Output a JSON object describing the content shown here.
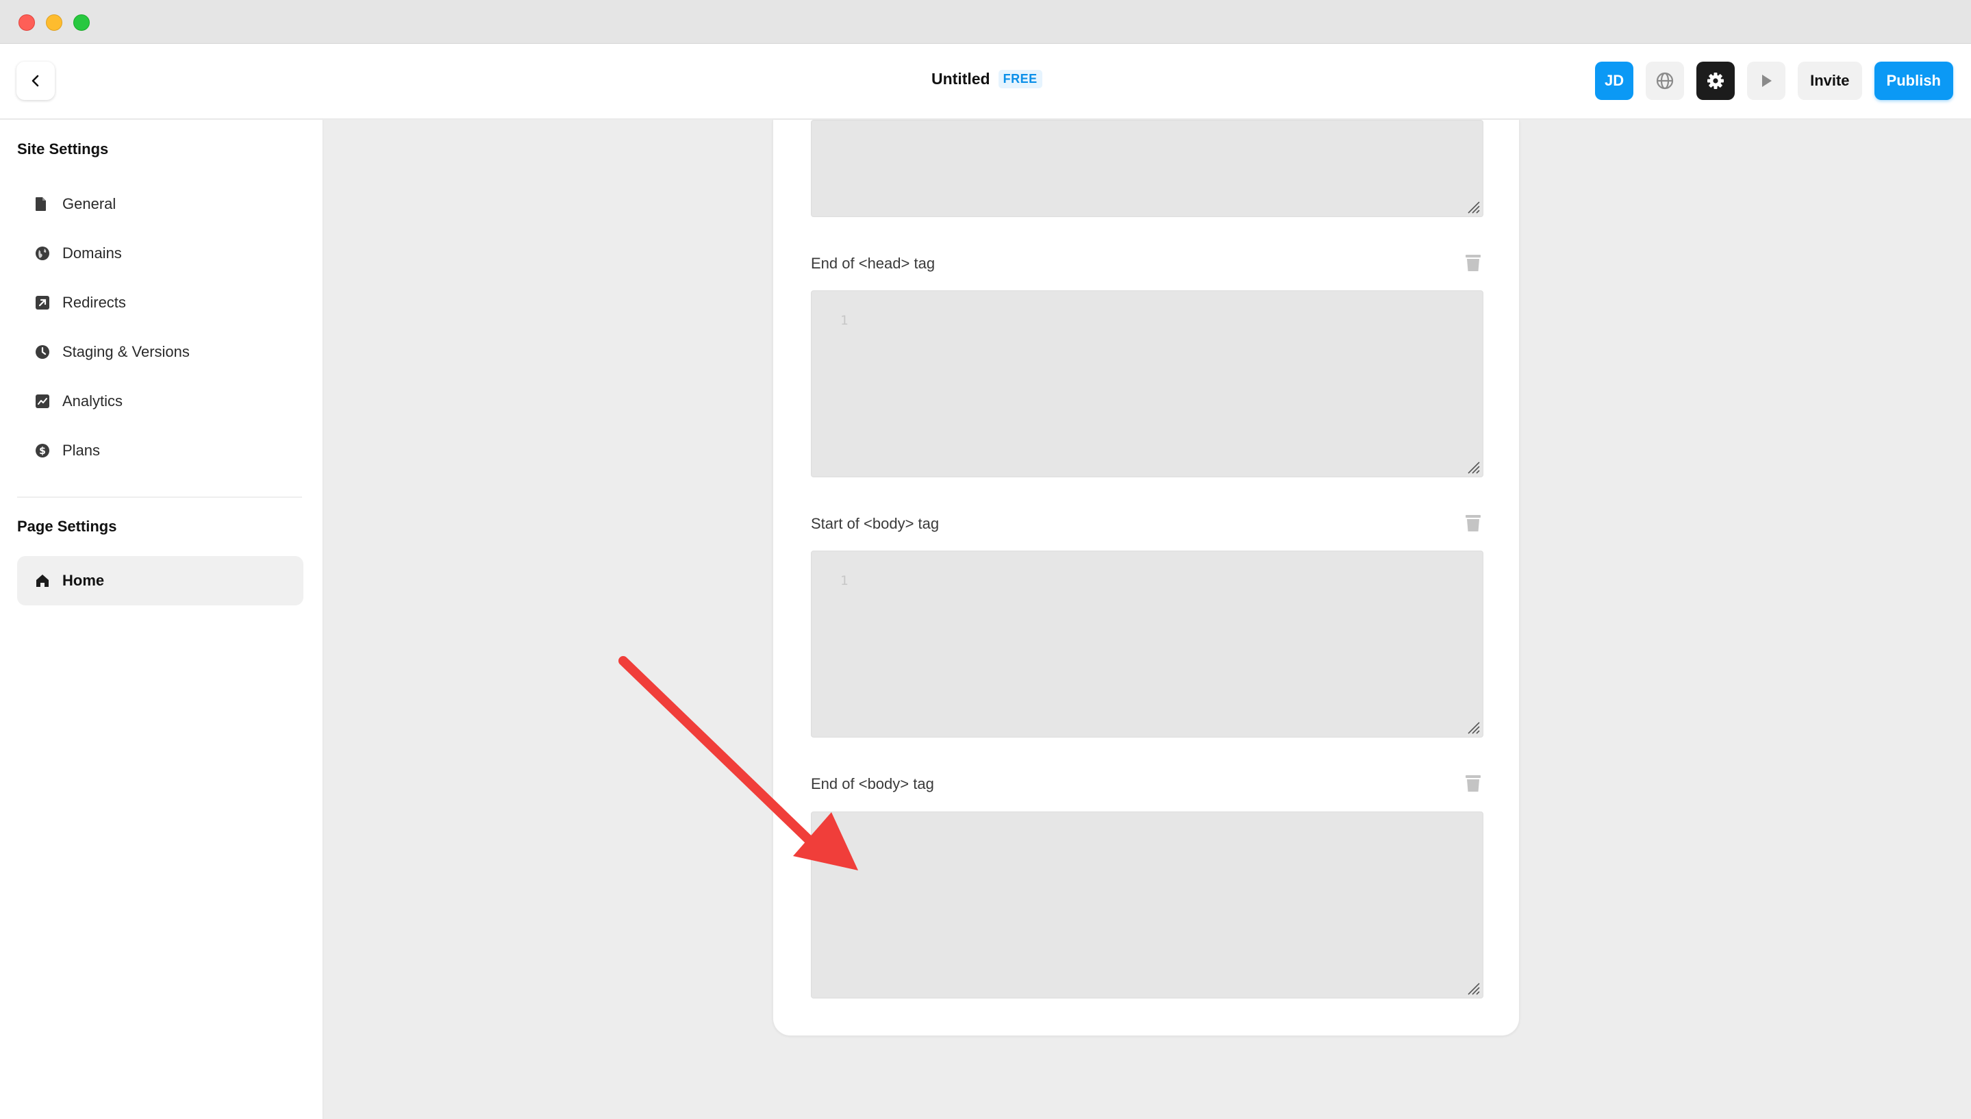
{
  "document": {
    "title": "Untitled",
    "plan_badge": "FREE"
  },
  "toolbar": {
    "avatar_initials": "JD",
    "invite_label": "Invite",
    "publish_label": "Publish",
    "icons": [
      "globe-icon",
      "gear-icon",
      "play-icon"
    ]
  },
  "sidebar": {
    "site_settings_title": "Site Settings",
    "site_items": [
      {
        "label": "General",
        "icon": "file-icon"
      },
      {
        "label": "Domains",
        "icon": "globe-icon"
      },
      {
        "label": "Redirects",
        "icon": "redirect-icon"
      },
      {
        "label": "Staging & Versions",
        "icon": "clock-icon"
      },
      {
        "label": "Analytics",
        "icon": "chart-icon"
      },
      {
        "label": "Plans",
        "icon": "dollar-icon"
      }
    ],
    "page_settings_title": "Page Settings",
    "page_items": [
      {
        "label": "Home",
        "icon": "home-icon",
        "active": true
      }
    ]
  },
  "code_fields": [
    {
      "label": "End of <head> tag",
      "line_number": "1"
    },
    {
      "label": "Start of <body> tag",
      "line_number": "1"
    },
    {
      "label": "End of <body> tag",
      "line_number": ""
    }
  ],
  "colors": {
    "accent": "#0b99f5",
    "annotation_arrow": "#f03e3a"
  }
}
